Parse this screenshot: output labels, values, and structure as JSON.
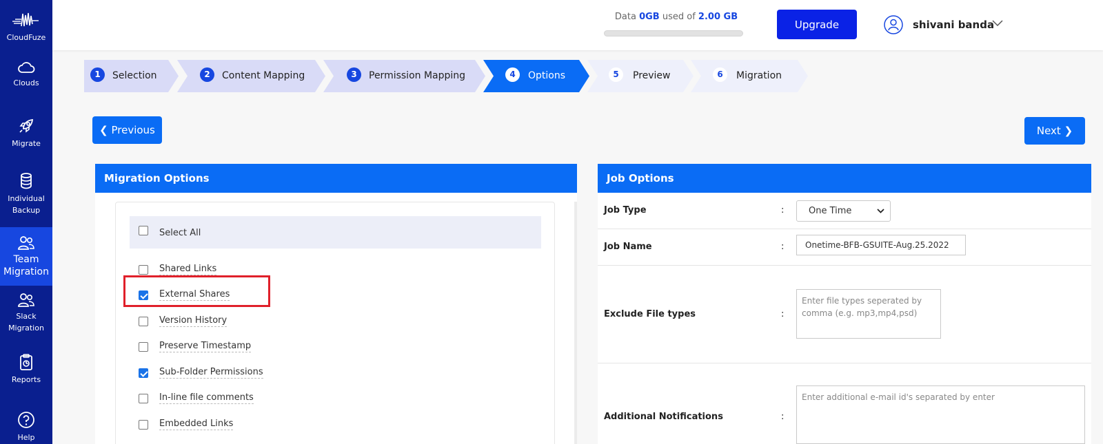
{
  "sidebar": {
    "brand": "CloudFuze",
    "items": [
      {
        "label": "Clouds"
      },
      {
        "label": "Migrate"
      },
      {
        "label": "Individual Backup"
      },
      {
        "label": "Team Migration"
      },
      {
        "label": "Slack Migration"
      },
      {
        "label": "Reports"
      },
      {
        "label": "Help"
      }
    ]
  },
  "header": {
    "storage_prefix": "Data",
    "storage_used": "0GB",
    "storage_mid": "used of",
    "storage_total": "2.00 GB",
    "storage_fraction": 0,
    "upgrade_label": "Upgrade",
    "user_name": "shivani banda"
  },
  "steps": [
    {
      "num": "1",
      "label": "Selection",
      "state": "done"
    },
    {
      "num": "2",
      "label": "Content Mapping",
      "state": "done"
    },
    {
      "num": "3",
      "label": "Permission Mapping",
      "state": "done"
    },
    {
      "num": "4",
      "label": "Options",
      "state": "active"
    },
    {
      "num": "5",
      "label": "Preview",
      "state": "todo"
    },
    {
      "num": "6",
      "label": "Migration",
      "state": "todo"
    }
  ],
  "nav": {
    "previous_label": "Previous",
    "next_label": "Next"
  },
  "migration_options": {
    "title": "Migration Options",
    "select_all_label": "Select All",
    "select_all_checked": false,
    "options": [
      {
        "label": "Shared Links",
        "checked": false
      },
      {
        "label": "External Shares",
        "checked": true
      },
      {
        "label": "Version History",
        "checked": false
      },
      {
        "label": "Preserve Timestamp",
        "checked": false
      },
      {
        "label": "Sub-Folder Permissions",
        "checked": true
      },
      {
        "label": "In-line file comments",
        "checked": false
      },
      {
        "label": "Embedded Links",
        "checked": false
      }
    ]
  },
  "job_options": {
    "title": "Job Options",
    "colon": ":",
    "job_type_label": "Job Type",
    "job_type_value": "One Time",
    "job_name_label": "Job Name",
    "job_name_value": "Onetime-BFB-GSUITE-Aug.25.2022",
    "exclude_label": "Exclude File types",
    "exclude_placeholder": "Enter file types seperated by comma (e.g. mp3,mp4,psd)",
    "notify_label": "Additional Notifications",
    "notify_placeholder": "Enter additional e-mail id's separated by enter"
  },
  "colors": {
    "sidebar": "#0a1f8f",
    "accent": "#0a6cf5",
    "upgrade": "#0a22e6",
    "highlight": "#e0202a"
  }
}
